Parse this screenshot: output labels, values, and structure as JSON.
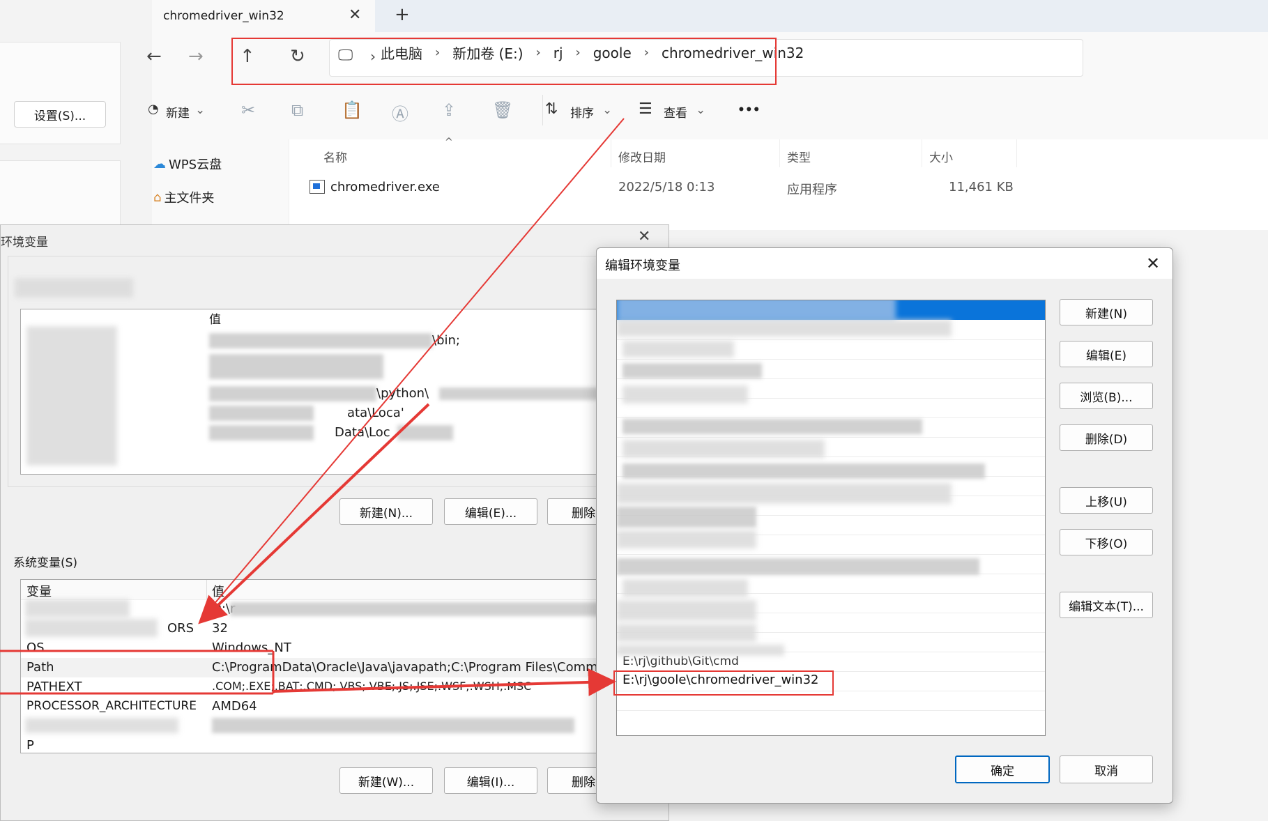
{
  "left_panel": {
    "settings_button": "设置(S)..."
  },
  "explorer": {
    "tab_title": "chromedriver_win32",
    "tab_close": "✕",
    "tab_add": "+",
    "nav_icons": {
      "back": "←",
      "forward": "→",
      "up": "↑",
      "refresh": "↻",
      "computer": "🖵",
      "chevron": "›"
    },
    "breadcrumb": [
      "此电脑",
      "新加卷 (E:)",
      "rj",
      "goole",
      "chromedriver_win32"
    ],
    "breadcrumb_sep": "›",
    "toolbar": {
      "new": "新建",
      "sort": "排序",
      "view": "查看",
      "more": "•••",
      "dropdown": "⌄"
    },
    "sidebar": [
      "WPS云盘",
      "主文件夹"
    ],
    "columns": {
      "name": "名称",
      "modified": "修改日期",
      "type": "类型",
      "size": "大小"
    },
    "files": [
      {
        "name": "chromedriver.exe",
        "modified": "2022/5/18 0:13",
        "type": "应用程序",
        "size": "11,461 KB"
      }
    ]
  },
  "env_dialog": {
    "title": "环境变量",
    "close": "✕",
    "user_vars": {
      "value_header_fragment": "值",
      "fragments": [
        "\\bin;",
        "\\python\\",
        "ca",
        "ata\\Loca'",
        "Data\\Loc"
      ],
      "buttons": {
        "new": "新建(N)...",
        "edit": "编辑(E)...",
        "delete": "删除"
      }
    },
    "system_vars": {
      "label": "系统变量(S)",
      "header_var": "变量",
      "header_value": "值",
      "rows": [
        {
          "name": "",
          "value": "D:\\r"
        },
        {
          "name": "ORS",
          "value": "32"
        },
        {
          "name": "OS",
          "value": "Windows_NT"
        },
        {
          "name": "Path",
          "value": "C:\\ProgramData\\Oracle\\Java\\javapath;C:\\Program Files\\Common"
        },
        {
          "name": "PATHEXT",
          "value": ".COM;.EXE;.BAT;.CMD;.VBS;.VBE;.JS;.JSE;.WSF;.WSH;.MSC"
        },
        {
          "name": "PROCESSOR_ARCHITECTURE",
          "value": "AMD64"
        },
        {
          "name": "P",
          "value": ""
        }
      ],
      "buttons": {
        "new": "新建(W)...",
        "edit": "编辑(I)...",
        "delete": "删除"
      }
    }
  },
  "edit_dialog": {
    "title": "编辑环境变量",
    "close": "✕",
    "entries_visible": [
      "E:\\rj\\github\\Git\\cmd",
      "E:\\rj\\goole\\chromedriver_win32"
    ],
    "buttons": {
      "new": "新建(N)",
      "edit": "编辑(E)",
      "browse": "浏览(B)...",
      "delete": "删除(D)",
      "move_up": "上移(U)",
      "move_down": "下移(O)",
      "edit_text": "编辑文本(T)...",
      "ok": "确定",
      "cancel": "取消"
    }
  },
  "colors": {
    "annotation_red": "#e53935",
    "selection_blue": "#0a74da",
    "accent": "#0067c0"
  }
}
